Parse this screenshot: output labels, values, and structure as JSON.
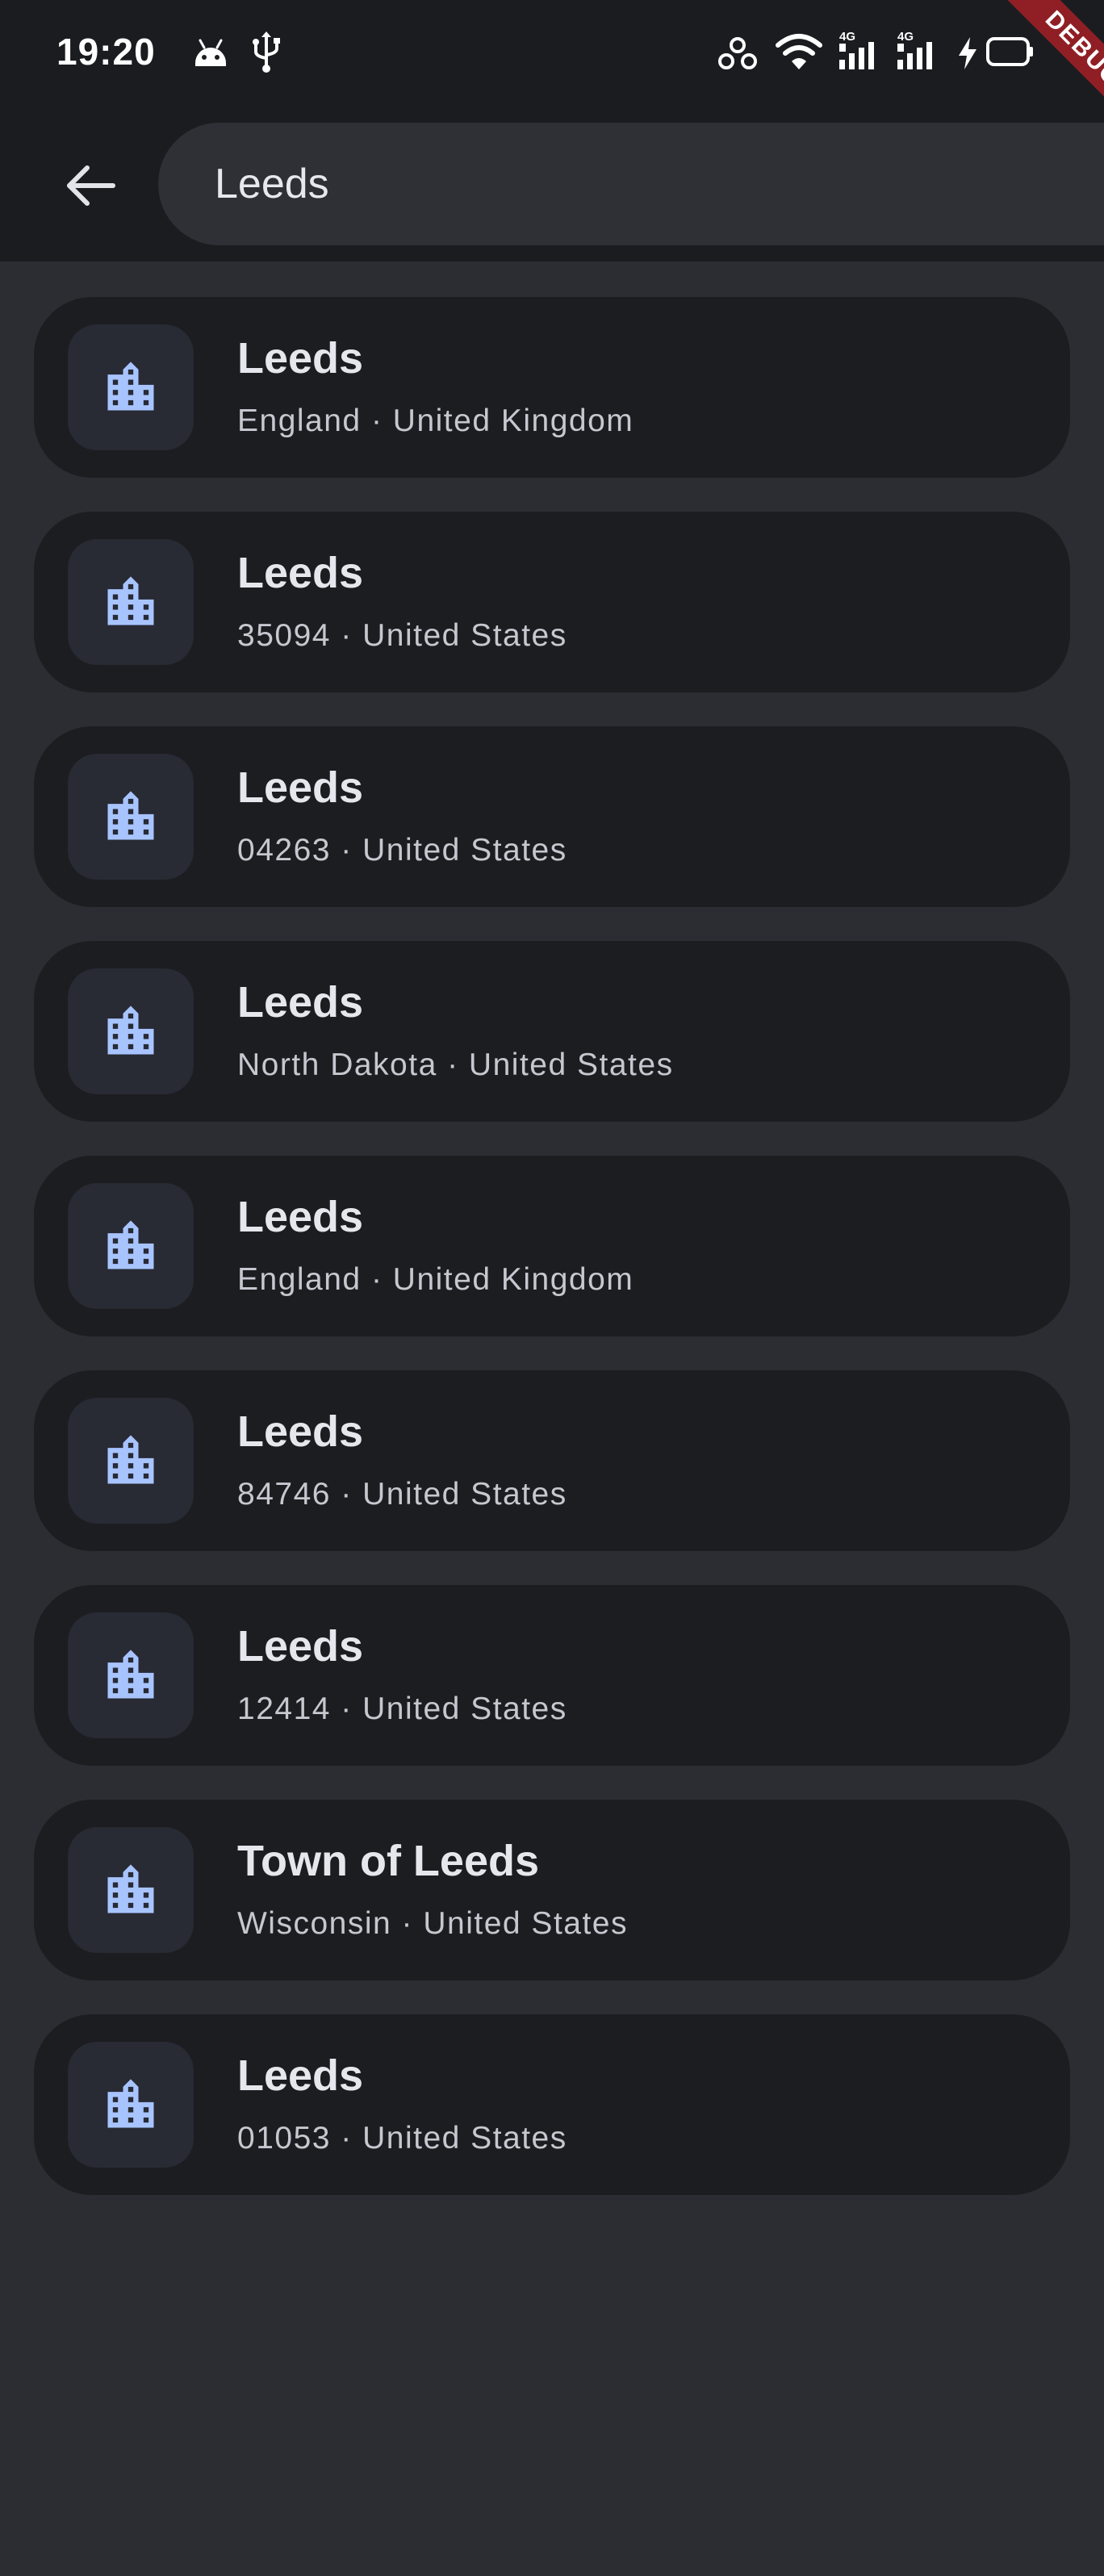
{
  "status_bar": {
    "time": "19:20",
    "network_labels": [
      "4G",
      "4G"
    ],
    "icons": [
      "android-icon",
      "usb-icon",
      "hotspot-icon",
      "wifi-icon",
      "signal-icon",
      "signal-icon",
      "charging-icon",
      "battery-icon"
    ]
  },
  "debug_banner": "DEBUG",
  "search": {
    "value": "Leeds",
    "back_icon": "arrow-left-icon"
  },
  "results": [
    {
      "title": "Leeds",
      "subtitle": "England · United Kingdom",
      "icon": "city-icon"
    },
    {
      "title": "Leeds",
      "subtitle": "35094 · United States",
      "icon": "city-icon"
    },
    {
      "title": "Leeds",
      "subtitle": "04263 · United States",
      "icon": "city-icon"
    },
    {
      "title": "Leeds",
      "subtitle": "North Dakota · United States",
      "icon": "city-icon"
    },
    {
      "title": "Leeds",
      "subtitle": "England · United Kingdom",
      "icon": "city-icon"
    },
    {
      "title": "Leeds",
      "subtitle": "84746 · United States",
      "icon": "city-icon"
    },
    {
      "title": "Leeds",
      "subtitle": "12414 · United States",
      "icon": "city-icon"
    },
    {
      "title": "Town of Leeds",
      "subtitle": "Wisconsin · United States",
      "icon": "city-icon"
    },
    {
      "title": "Leeds",
      "subtitle": "01053 · United States",
      "icon": "city-icon"
    }
  ],
  "colors": {
    "background": "#2c2d32",
    "top_bar": "#1b1c20",
    "card": "#1c1d21",
    "icon_tile": "#282a34",
    "icon_accent": "#a8c4ff",
    "debug_ribbon": "#8f1f24"
  }
}
